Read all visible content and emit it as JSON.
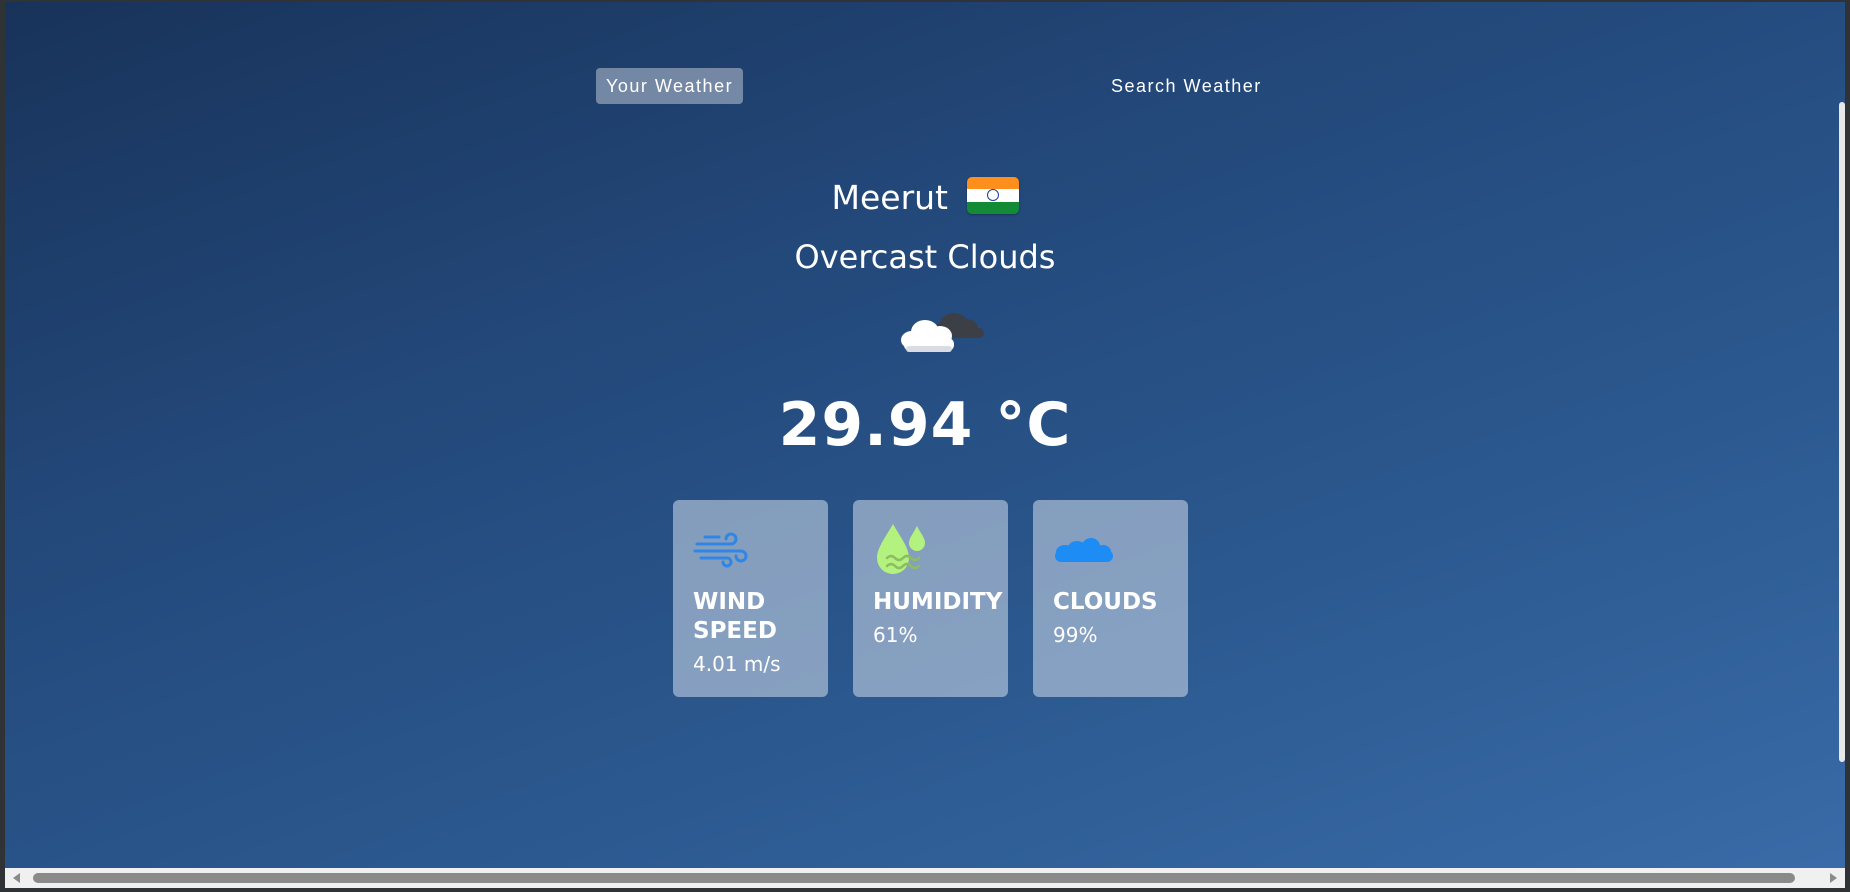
{
  "nav": {
    "tabs": [
      {
        "label": "Your Weather",
        "active": true
      },
      {
        "label": "Search Weather",
        "active": false
      }
    ]
  },
  "weather": {
    "city": "Meerut",
    "country_flag": "india-flag-icon",
    "description": "Overcast Clouds",
    "condition_icon": "overcast-clouds-icon",
    "temperature": "29.94 °C"
  },
  "stats": [
    {
      "label": "WIND SPEED",
      "value": "4.01 m/s",
      "icon": "wind-icon",
      "color": "#2f86e6"
    },
    {
      "label": "HUMIDITY",
      "value": "61%",
      "icon": "humidity-icon",
      "color": "#b3f27f"
    },
    {
      "label": "CLOUDS",
      "value": "99%",
      "icon": "clouds-icon",
      "color": "#1d8cf5"
    }
  ],
  "colors": {
    "background_top": "#18335a",
    "background_bottom": "#3a6ba8",
    "card": "#becde1",
    "text": "#ffffff"
  }
}
